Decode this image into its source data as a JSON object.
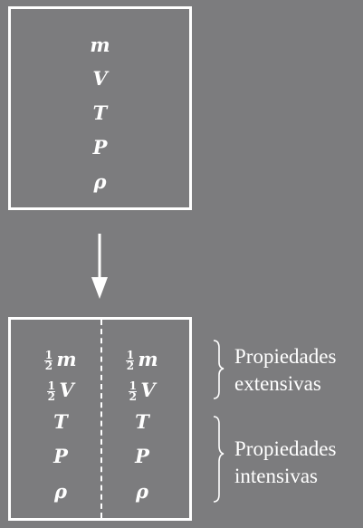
{
  "top_box": {
    "symbols": [
      "m",
      "V",
      "T",
      "P",
      "ρ"
    ]
  },
  "bottom_box": {
    "half_numerator": "1",
    "half_denominator": "2",
    "left": [
      "m",
      "V",
      "T",
      "P",
      "ρ"
    ],
    "right": [
      "m",
      "V",
      "T",
      "P",
      "ρ"
    ]
  },
  "labels": {
    "extensive_line1": "Propiedades",
    "extensive_line2": "extensivas",
    "intensive_line1": "Propiedades",
    "intensive_line2": "intensivas"
  },
  "colors": {
    "background": "#7c7c7e",
    "foreground": "#ffffff"
  },
  "icons": {
    "arrow": "arrow-down-icon",
    "brace": "right-brace-icon"
  }
}
